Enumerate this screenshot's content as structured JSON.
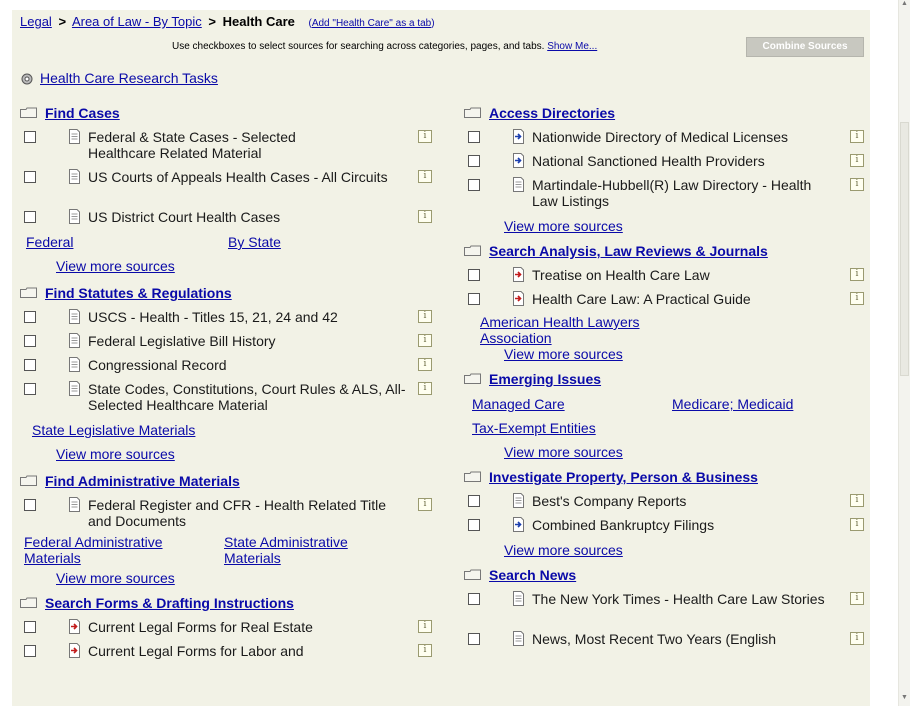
{
  "breadcrumb": {
    "legal": "Legal",
    "sep": ">",
    "area": "Area of Law - By Topic",
    "current": "Health Care",
    "add_tab_open": "(",
    "add_tab": "Add \"Health Care\" as a tab",
    "add_tab_close": ")"
  },
  "combine": {
    "instruction": "Use checkboxes to select sources for searching across categories, pages, and tabs.",
    "show_me": "Show Me...",
    "button": "Combine Sources"
  },
  "research_tasks": "Health Care Research Tasks",
  "left": {
    "find_cases": {
      "title": "Find Cases",
      "items": [
        {
          "label": "Federal & State Cases - Selected Healthcare Related Material"
        },
        {
          "label": "US Courts of Appeals Health Cases - All Circuits"
        },
        {
          "label": "US District Court Health Cases"
        }
      ],
      "link1": "Federal",
      "link2": "By State",
      "more": "View more sources"
    },
    "statutes": {
      "title": "Find Statutes & Regulations",
      "items": [
        {
          "label": "USCS - Health - Titles 15, 21, 24 and 42"
        },
        {
          "label": "Federal Legislative Bill History"
        },
        {
          "label": "Congressional Record"
        },
        {
          "label": "State Codes, Constitutions, Court Rules & ALS, All-Selected Healthcare Material"
        }
      ],
      "link1": "State Legislative Materials",
      "more": "View more sources"
    },
    "admin": {
      "title": "Find Administrative Materials",
      "items": [
        {
          "label": "Federal Register and CFR - Health Related Title and Documents"
        }
      ],
      "link1": "Federal Administrative Materials",
      "link2": "State Administrative Materials",
      "more": "View more sources"
    },
    "forms": {
      "title": "Search Forms & Drafting Instructions",
      "items": [
        {
          "label": "Current Legal Forms for Real Estate"
        },
        {
          "label": "Current Legal Forms for Labor and"
        }
      ]
    }
  },
  "right": {
    "directories": {
      "title": "Access Directories",
      "items": [
        {
          "label": "Nationwide Directory of Medical Licenses"
        },
        {
          "label": "National Sanctioned Health Providers"
        },
        {
          "label": "Martindale-Hubbell(R) Law Directory - Health Law Listings"
        }
      ],
      "more": "View more sources"
    },
    "analysis": {
      "title": "Search Analysis, Law Reviews & Journals",
      "items": [
        {
          "label": "Treatise on Health Care Law"
        },
        {
          "label": "Health Care Law: A Practical Guide"
        }
      ],
      "link1": "American Health Lawyers Association",
      "more": "View more sources"
    },
    "emerging": {
      "title": "Emerging Issues",
      "link1": "Managed Care",
      "link2": "Medicare; Medicaid",
      "link3": "Tax-Exempt Entities",
      "more": "View more sources"
    },
    "property": {
      "title": "Investigate Property, Person & Business",
      "items": [
        {
          "label": "Best's Company Reports"
        },
        {
          "label": "Combined Bankruptcy Filings"
        }
      ],
      "more": "View more sources"
    },
    "news": {
      "title": "Search News",
      "items": [
        {
          "label": "The New York Times - Health Care Law Stories"
        },
        {
          "label": "News, Most Recent Two Years (English"
        }
      ]
    }
  },
  "icons": {
    "info": "i",
    "doc": "document-icon",
    "arrow": "arrow-doc-icon",
    "folder": "folder-icon"
  },
  "colors": {
    "panel": "#f2f2e6",
    "link": "#0a0aa8",
    "button": "#c8c8c0"
  }
}
